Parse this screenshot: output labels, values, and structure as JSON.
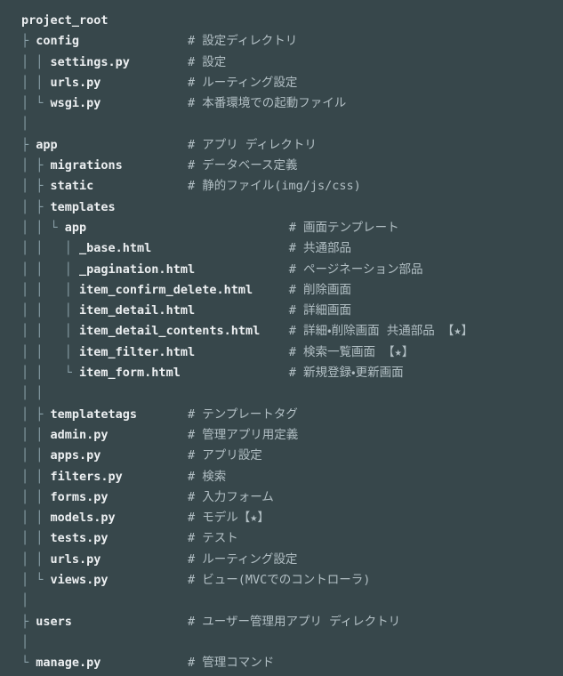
{
  "terminal": {
    "background_color": "#37474b",
    "guide_color": "#8aa0a8",
    "name_color": "#eceff1",
    "comment_color": "#b2bfc4",
    "root_label": "project_root"
  },
  "tree": {
    "rows": [
      {
        "guide": "",
        "name": "project_root",
        "comment": ""
      },
      {
        "guide": "├ ",
        "name": "config",
        "comment": "# 設定ディレクトリ"
      },
      {
        "guide": "│ │ ",
        "name": "settings.py",
        "comment": "# 設定"
      },
      {
        "guide": "│ │ ",
        "name": "urls.py",
        "comment": "# ルーティング設定"
      },
      {
        "guide": "│ └ ",
        "name": "wsgi.py",
        "comment": "# 本番環境での起動ファイル"
      },
      {
        "guide": "│",
        "name": "",
        "comment": ""
      },
      {
        "guide": "├ ",
        "name": "app",
        "comment": "# アプリ ディレクトリ"
      },
      {
        "guide": "│ ├ ",
        "name": "migrations",
        "comment": "# データベース定義"
      },
      {
        "guide": "│ ├ ",
        "name": "static",
        "comment": "# 静的ファイル(img/js/css)"
      },
      {
        "guide": "│ ├ ",
        "name": "templates",
        "comment": ""
      },
      {
        "guide": "│ │ └ ",
        "name": "app",
        "comment": "# 画面テンプレート"
      },
      {
        "guide": "│ │   │ ",
        "name": "_base.html",
        "comment": "# 共通部品"
      },
      {
        "guide": "│ │   │ ",
        "name": "_pagination.html",
        "comment": "# ページネーション部品"
      },
      {
        "guide": "│ │   │ ",
        "name": "item_confirm_delete.html",
        "comment": "# 削除画面"
      },
      {
        "guide": "│ │   │ ",
        "name": "item_detail.html",
        "comment": "# 詳細画面"
      },
      {
        "guide": "│ │   │ ",
        "name": "item_detail_contents.html",
        "comment": "# 詳細・削除画面 共通部品 【★】"
      },
      {
        "guide": "│ │   │ ",
        "name": "item_filter.html",
        "comment": "# 検索一覧画面 【★】"
      },
      {
        "guide": "│ │   └ ",
        "name": "item_form.html",
        "comment": "# 新規登録・更新画面"
      },
      {
        "guide": "│ │",
        "name": "",
        "comment": ""
      },
      {
        "guide": "│ ├ ",
        "name": "templatetags",
        "comment": "# テンプレートタグ"
      },
      {
        "guide": "│ │ ",
        "name": "admin.py",
        "comment": "# 管理アプリ用定義"
      },
      {
        "guide": "│ │ ",
        "name": "apps.py",
        "comment": "# アプリ設定"
      },
      {
        "guide": "│ │ ",
        "name": "filters.py",
        "comment": "# 検索"
      },
      {
        "guide": "│ │ ",
        "name": "forms.py",
        "comment": "# 入力フォーム"
      },
      {
        "guide": "│ │ ",
        "name": "models.py",
        "comment": "# モデル【★】"
      },
      {
        "guide": "│ │ ",
        "name": "tests.py",
        "comment": "# テスト"
      },
      {
        "guide": "│ │ ",
        "name": "urls.py",
        "comment": "# ルーティング設定"
      },
      {
        "guide": "│ └ ",
        "name": "views.py",
        "comment": "# ビュー(MVCでのコントローラ)"
      },
      {
        "guide": "│",
        "name": "",
        "comment": ""
      },
      {
        "guide": "├ ",
        "name": "users",
        "comment": "# ユーザー管理用アプリ ディレクトリ"
      },
      {
        "guide": "│",
        "name": "",
        "comment": ""
      },
      {
        "guide": "└ ",
        "name": "manage.py",
        "comment": "# 管理コマンド"
      }
    ],
    "comment_column": 23,
    "comment_column_deep": 37
  }
}
